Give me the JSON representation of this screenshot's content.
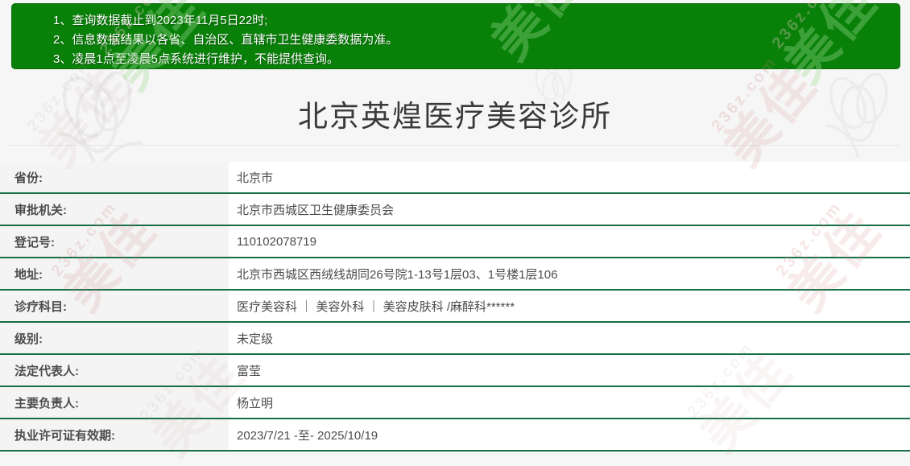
{
  "notice": {
    "lines": [
      "1、查询数据截止到2023年11月5日22时;",
      "2、信息数据结果以各省、自治区、直辖市卫生健康委数据为准。",
      "3、凌晨1点至凌晨5点系统进行维护，不能提供查询。"
    ]
  },
  "clinic": {
    "title": "北京英煌医疗美容诊所",
    "fields": [
      {
        "label": "省份:",
        "value": "北京市"
      },
      {
        "label": "审批机关:",
        "value": "北京市西城区卫生健康委员会"
      },
      {
        "label": "登记号:",
        "value": "110102078719"
      },
      {
        "label": "地址:",
        "value": "北京市西城区西绒线胡同26号院1-13号1层03、1号楼1层106"
      },
      {
        "label": "诊疗科目:",
        "value": "医疗美容科 ｜ 美容外科 ｜ 美容皮肤科 /麻醉科******"
      },
      {
        "label": "级别:",
        "value": "未定级"
      },
      {
        "label": "法定代表人:",
        "value": "富莹"
      },
      {
        "label": "主要负责人:",
        "value": "杨立明"
      },
      {
        "label": "执业许可证有效期:",
        "value": "2023/7/21 -至- 2025/10/19"
      }
    ]
  },
  "watermark": {
    "site": "236z.com",
    "brand": "美佳"
  },
  "colors": {
    "banner_green": "#098109",
    "separator_green": "#156e46",
    "label_bg": "#f4f4f4",
    "page_bg": "#f6f6f6"
  }
}
